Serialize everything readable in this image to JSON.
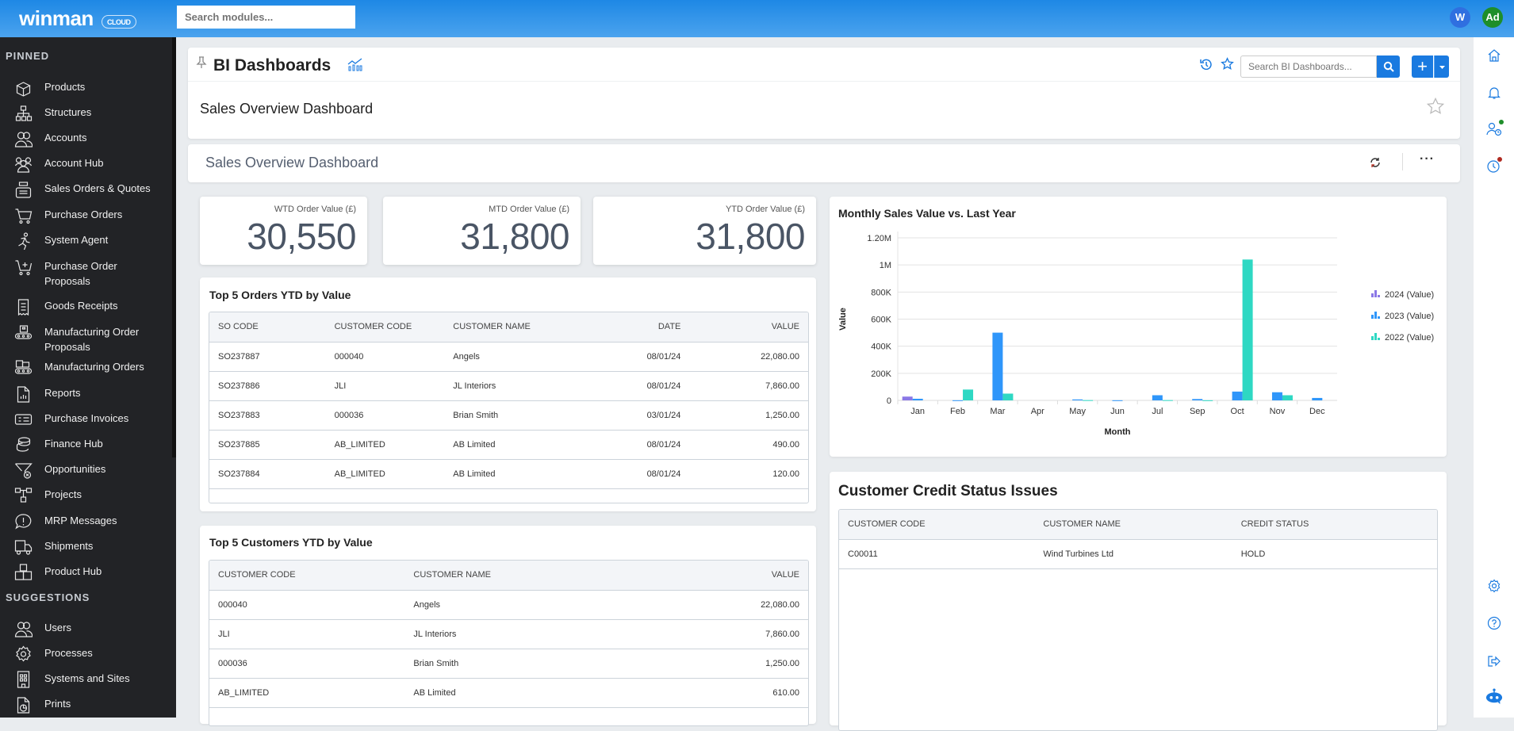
{
  "topbar": {
    "logo": "winman",
    "logo_badge": "CLOUD",
    "search_placeholder": "Search modules...",
    "app_avatar": "W",
    "user_avatar": "Ad",
    "app_avatar_color": "#2f6fe0",
    "user_avatar_color": "#1e8e2a"
  },
  "sidebar": {
    "pinned_label": "PINNED",
    "suggestions_label": "SUGGESTIONS",
    "pinned": [
      {
        "label": "Products",
        "icon": "box-open-icon"
      },
      {
        "label": "Structures",
        "icon": "hierarchy-icon"
      },
      {
        "label": "Accounts",
        "icon": "users-icon"
      },
      {
        "label": "Account Hub",
        "icon": "users-group-icon"
      },
      {
        "label": "Sales Orders & Quotes",
        "icon": "cash-register-icon"
      },
      {
        "label": "Purchase Orders",
        "icon": "cart-icon"
      },
      {
        "label": "System Agent",
        "icon": "running-person-icon"
      },
      {
        "label": "Purchase Order Proposals",
        "icon": "cart-plus-icon"
      },
      {
        "label": "Goods Receipts",
        "icon": "receipt-icon"
      },
      {
        "label": "Manufacturing Order Proposals",
        "icon": "conveyor-box-icon"
      },
      {
        "label": "Manufacturing Orders",
        "icon": "conveyor-icon"
      },
      {
        "label": "Reports",
        "icon": "report-icon"
      },
      {
        "label": "Purchase Invoices",
        "icon": "invoice-icon"
      },
      {
        "label": "Finance Hub",
        "icon": "coins-icon"
      },
      {
        "label": "Opportunities",
        "icon": "funnel-icon"
      },
      {
        "label": "Projects",
        "icon": "project-nodes-icon"
      },
      {
        "label": "MRP Messages",
        "icon": "message-alert-icon"
      },
      {
        "label": "Shipments",
        "icon": "truck-icon"
      },
      {
        "label": "Product Hub",
        "icon": "boxes-icon"
      }
    ],
    "suggestions": [
      {
        "label": "Users",
        "icon": "users-icon"
      },
      {
        "label": "Processes",
        "icon": "gear-icon"
      },
      {
        "label": "Systems and Sites",
        "icon": "building-icon"
      },
      {
        "label": "Prints",
        "icon": "print-file-icon"
      }
    ]
  },
  "header": {
    "title": "BI Dashboards",
    "search_placeholder": "Search BI Dashboards...",
    "subtitle": "Sales Overview Dashboard",
    "accent": "#1a7ae0"
  },
  "dashboard": {
    "title": "Sales Overview Dashboard",
    "kpis": [
      {
        "label": "WTD Order Value (£)",
        "value": "30,550"
      },
      {
        "label": "MTD Order Value (£)",
        "value": "31,800"
      },
      {
        "label": "YTD Order Value (£)",
        "value": "31,800"
      }
    ],
    "top_orders": {
      "title": "Top 5 Orders YTD by Value",
      "headers": [
        "SO CODE",
        "CUSTOMER CODE",
        "CUSTOMER NAME",
        "DATE",
        "VALUE"
      ],
      "rows": [
        [
          "SO237887",
          "000040",
          "Angels",
          "08/01/24",
          "22,080.00"
        ],
        [
          "SO237886",
          "JLI",
          "JL Interiors",
          "08/01/24",
          "7,860.00"
        ],
        [
          "SO237883",
          "000036",
          "Brian Smith",
          "03/01/24",
          "1,250.00"
        ],
        [
          "SO237885",
          "AB_LIMITED",
          "AB Limited",
          "08/01/24",
          "490.00"
        ],
        [
          "SO237884",
          "AB_LIMITED",
          "AB Limited",
          "08/01/24",
          "120.00"
        ]
      ]
    },
    "top_customers": {
      "title": "Top 5 Customers YTD by Value",
      "headers": [
        "CUSTOMER CODE",
        "CUSTOMER NAME",
        "VALUE"
      ],
      "rows": [
        [
          "000040",
          "Angels",
          "22,080.00"
        ],
        [
          "JLI",
          "JL Interiors",
          "7,860.00"
        ],
        [
          "000036",
          "Brian Smith",
          "1,250.00"
        ],
        [
          "AB_LIMITED",
          "AB Limited",
          "610.00"
        ]
      ]
    },
    "credit": {
      "title": "Customer Credit Status Issues",
      "headers": [
        "CUSTOMER CODE",
        "CUSTOMER NAME",
        "CREDIT STATUS"
      ],
      "rows": [
        [
          "C00011",
          "Wind Turbines Ltd",
          "HOLD"
        ]
      ]
    }
  },
  "chart_data": {
    "type": "bar",
    "title": "Monthly Sales Value vs. Last Year",
    "xlabel": "Month",
    "ylabel": "Value",
    "ylim": [
      0,
      1200000
    ],
    "yticks": [
      0,
      200000,
      400000,
      600000,
      800000,
      1000000,
      1200000
    ],
    "ytick_labels": [
      "0",
      "200K",
      "400K",
      "600K",
      "800K",
      "1M",
      "1.20M"
    ],
    "grid": true,
    "legend": "right",
    "categories": [
      "Jan",
      "Feb",
      "Mar",
      "Apr",
      "May",
      "Jun",
      "Jul",
      "Sep",
      "Oct",
      "Nov",
      "Dec"
    ],
    "series": [
      {
        "name": "2024 (Value)",
        "color": "#8b78e6",
        "values": [
          28000,
          0,
          0,
          0,
          0,
          0,
          0,
          0,
          0,
          0,
          0
        ]
      },
      {
        "name": "2023 (Value)",
        "color": "#2f96fa",
        "values": [
          12000,
          1000,
          500000,
          0,
          7000,
          1000,
          38000,
          10000,
          65000,
          60000,
          18000
        ]
      },
      {
        "name": "2022 (Value)",
        "color": "#2ed8c3",
        "values": [
          0,
          80000,
          50000,
          0,
          2000,
          0,
          2000,
          1000,
          1040000,
          38000,
          0
        ]
      }
    ]
  }
}
